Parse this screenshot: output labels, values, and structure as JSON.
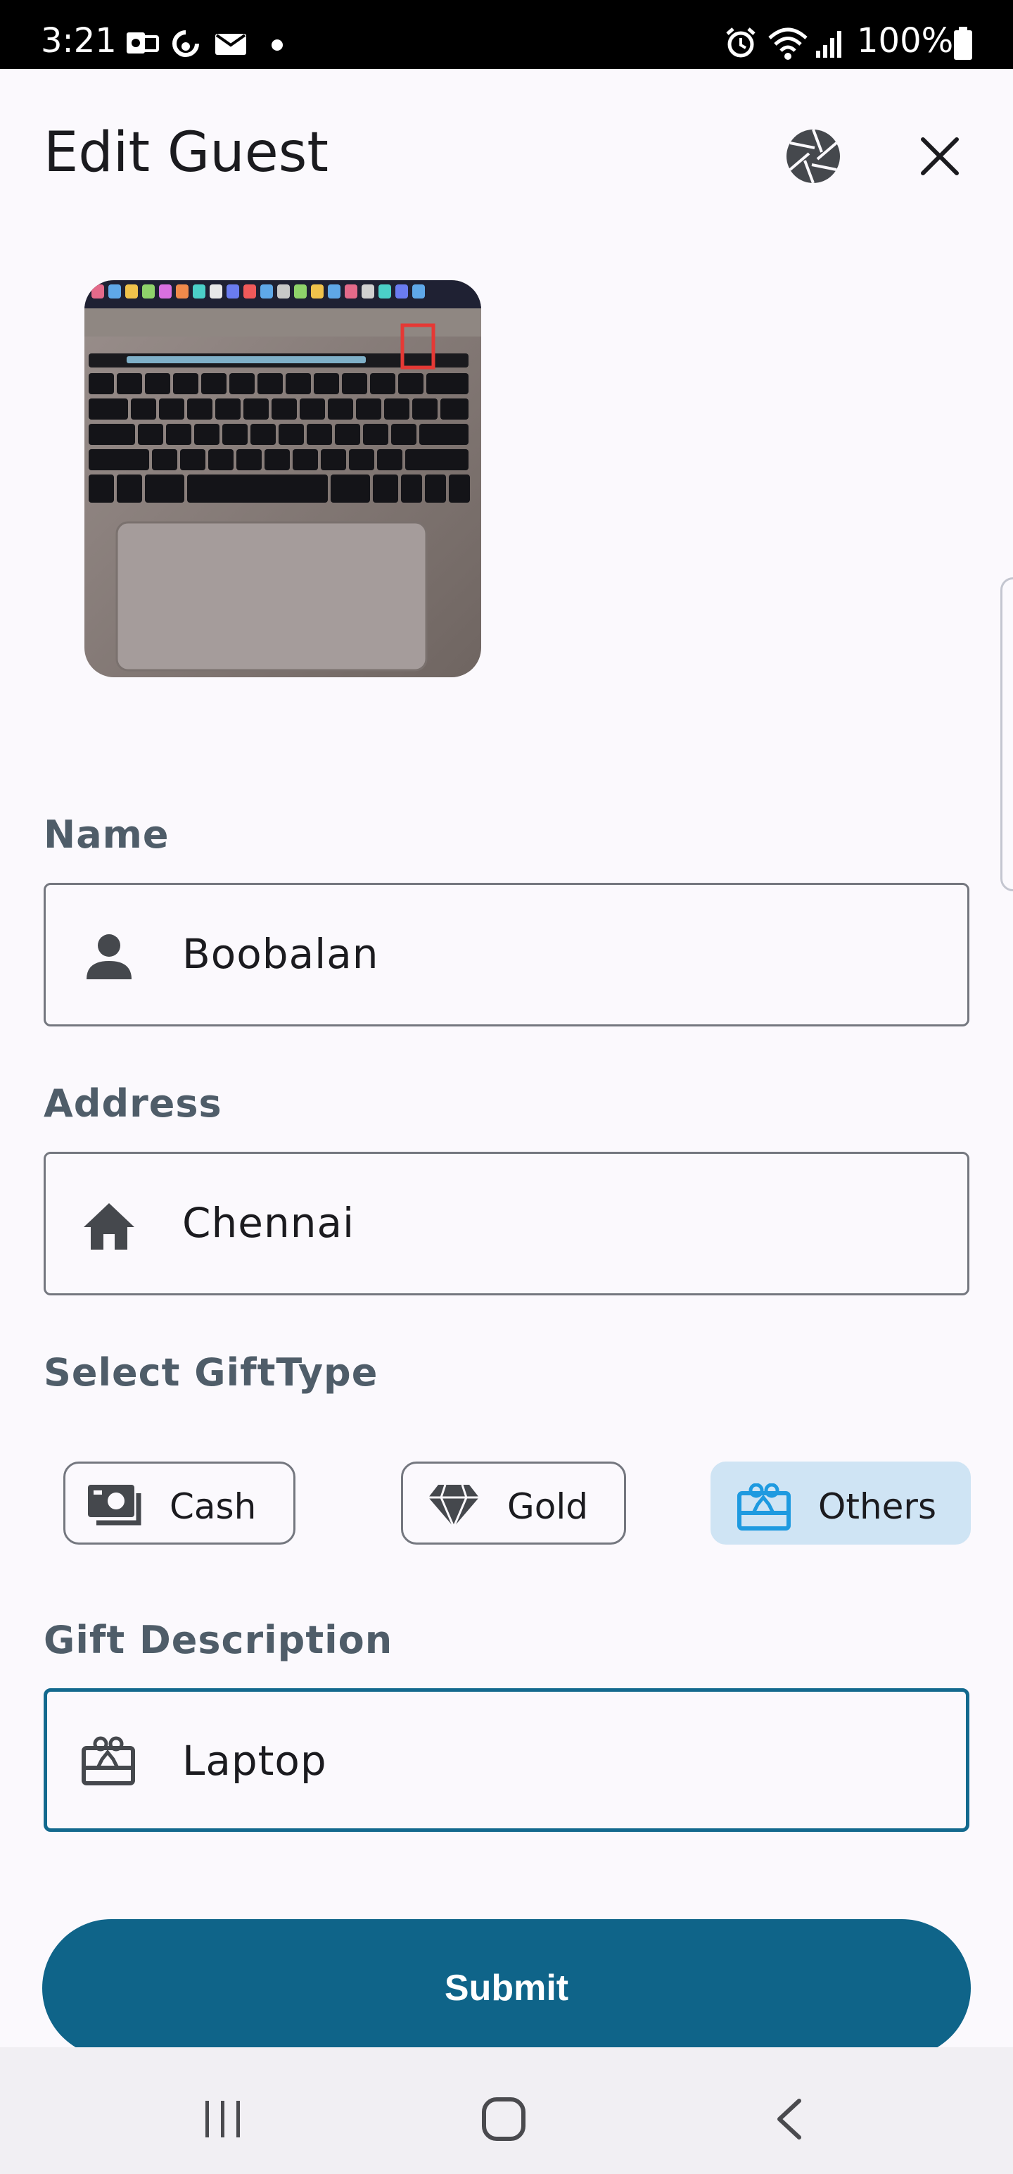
{
  "status_bar": {
    "time": "3:21",
    "battery_text": "100%"
  },
  "header": {
    "title": "Edit Guest"
  },
  "form": {
    "name": {
      "label": "Name",
      "value": "Boobalan"
    },
    "address": {
      "label": "Address",
      "value": "Chennai"
    },
    "gift_type": {
      "label": "Select GiftType",
      "options": [
        {
          "label": "Cash",
          "selected": false
        },
        {
          "label": "Gold",
          "selected": false
        },
        {
          "label": "Others",
          "selected": true
        }
      ]
    },
    "gift_description": {
      "label": "Gift Description",
      "value": "Laptop"
    }
  },
  "actions": {
    "submit_label": "Submit"
  },
  "colors": {
    "primary": "#0f6489",
    "selected_chip_bg": "#cfe4f4",
    "selected_icon": "#1e9ae0",
    "label": "#4f5d69",
    "delete_icon": "#e53935"
  },
  "icons": {
    "camera": "camera-aperture-icon",
    "close": "close-icon",
    "delete": "trash-icon",
    "person": "person-icon",
    "home": "home-icon",
    "cash": "cash-icon",
    "gold": "diamond-icon",
    "others": "gift-card-icon"
  }
}
